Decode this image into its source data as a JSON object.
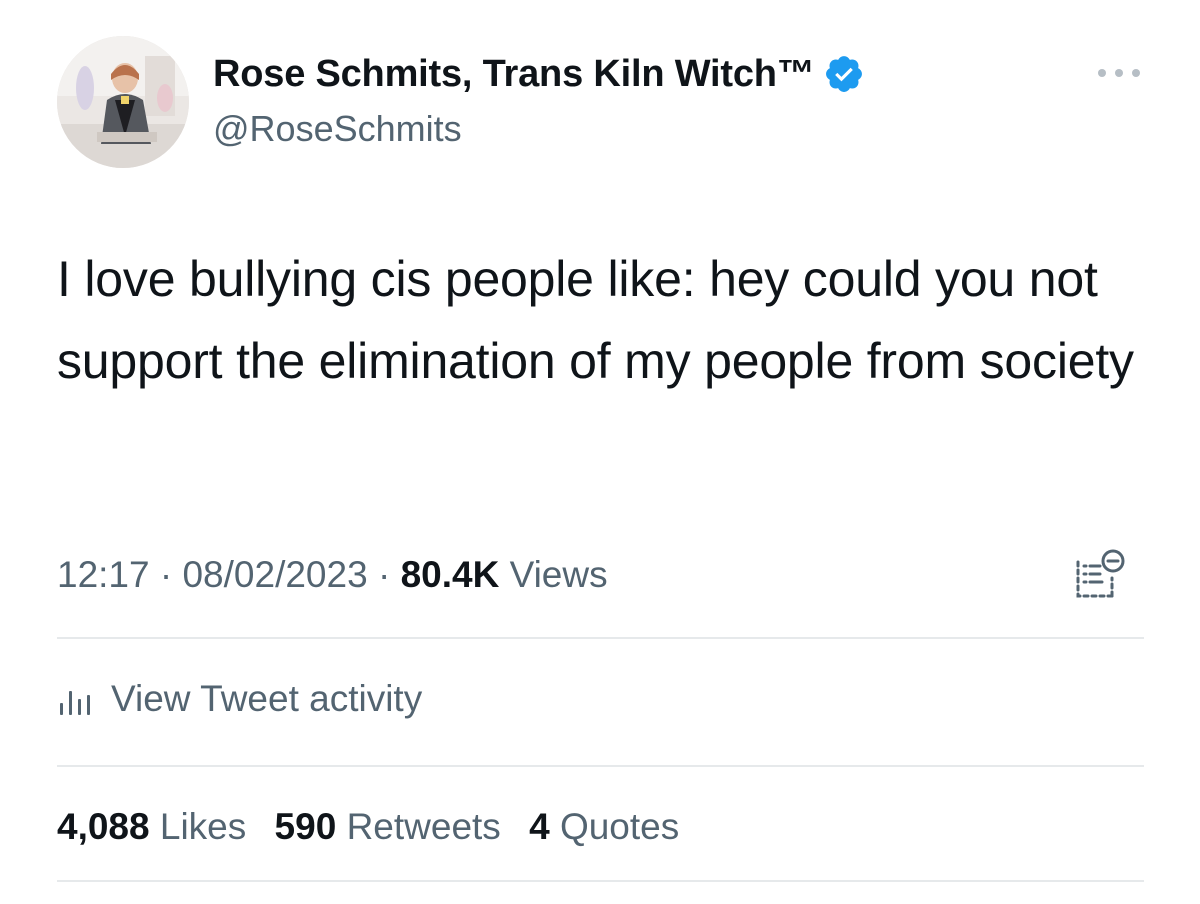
{
  "author": {
    "display_name": "Rose Schmits, Trans Kiln Witch™",
    "handle": "@RoseSchmits",
    "verified": true,
    "avatar_icon": "profile-photo"
  },
  "tweet": {
    "text": "I love bullying cis people like: hey could you not support the elimination of my people from society",
    "time": "12:17",
    "date": "08/02/2023",
    "views_count": "80.4K",
    "views_label": "Views",
    "separator": "·"
  },
  "activity": {
    "label": "View Tweet activity",
    "icon": "bar-chart-icon"
  },
  "stats": {
    "likes_count": "4,088",
    "likes_label": "Likes",
    "retweets_count": "590",
    "retweets_label": "Retweets",
    "quotes_count": "4",
    "quotes_label": "Quotes"
  },
  "colors": {
    "verified_blue": "#1d9bf0",
    "secondary_text": "#536471",
    "primary_text": "#0f1419",
    "divider": "#e6e9eb"
  }
}
